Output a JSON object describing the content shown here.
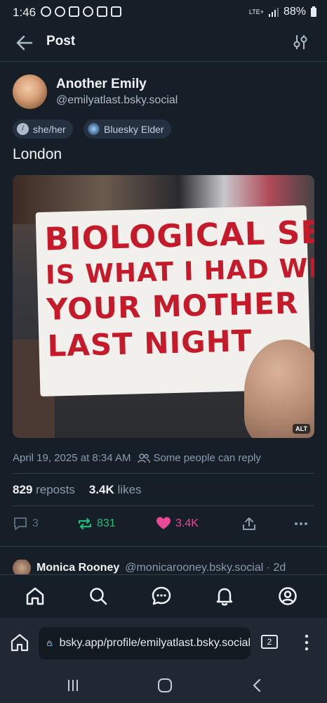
{
  "status_bar": {
    "time": "1:46",
    "network": "LTE+",
    "battery": "88%"
  },
  "header": {
    "title": "Post"
  },
  "author": {
    "display_name": "Another Emily",
    "handle": "@emilyatlast.bsky.social",
    "badges": [
      {
        "label": "she/her",
        "icon": "pronoun-icon"
      },
      {
        "label": "Bluesky Elder",
        "icon": "elder-badge-icon"
      }
    ]
  },
  "post": {
    "text": "London",
    "image": {
      "sign_lines": [
        "BIOLOGICAL SEX",
        "IS WHAT I HAD WITH",
        "YOUR MOTHER",
        "LAST NIGHT"
      ],
      "alt_badge": "ALT"
    },
    "timestamp": "April 19, 2025 at 8:34 AM",
    "reply_restriction": "Some people can reply",
    "stats": {
      "reposts_count": "829",
      "reposts_label": "reposts",
      "likes_count": "3.4K",
      "likes_label": "likes"
    },
    "actions": {
      "reply_count": "3",
      "repost_count": "831",
      "like_count": "3.4K"
    }
  },
  "reply_preview": {
    "name": "Monica Rooney",
    "handle": "@monicarooney.bsky.social · 2d"
  },
  "bottom_nav": [
    "home-icon",
    "search-icon",
    "chat-icon",
    "bell-icon",
    "profile-icon"
  ],
  "browser": {
    "url": "bsky.app/profile/emilyatlast.bsky.social",
    "tab_count": "2"
  },
  "colors": {
    "background": "#161e27",
    "repost": "#20bc7a",
    "like": "#ec4899",
    "muted": "#8b9bb0"
  }
}
